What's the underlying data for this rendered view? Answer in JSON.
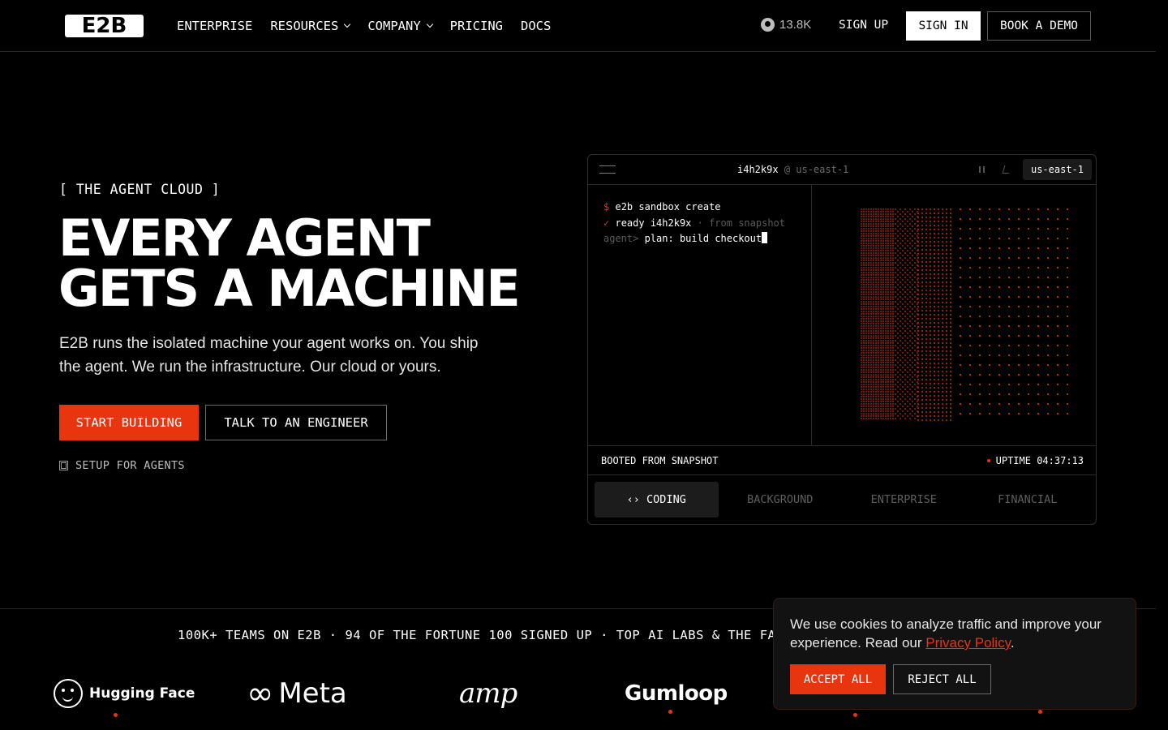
{
  "nav": {
    "logo": "E2B",
    "links": [
      {
        "label": "ENTERPRISE",
        "dropdown": false
      },
      {
        "label": "RESOURCES",
        "dropdown": true
      },
      {
        "label": "COMPANY",
        "dropdown": true
      },
      {
        "label": "PRICING",
        "dropdown": false
      },
      {
        "label": "DOCS",
        "dropdown": false
      }
    ],
    "github_icon": "github-icon",
    "github_stars": "13.8K",
    "sign_up": "SIGN UP",
    "sign_in": "SIGN IN",
    "book_demo": "BOOK A DEMO"
  },
  "hero": {
    "eyebrow": "[ THE AGENT CLOUD ]",
    "headline_line1": "EVERY AGENT",
    "headline_line2": "GETS A MACHINE",
    "subtext": "E2B runs the isolated machine your agent works on. You ship the agent. We run the infrastructure. Our cloud or yours.",
    "cta_primary": "START BUILDING",
    "cta_secondary": "TALK TO AN ENGINEER",
    "setup_link": "SETUP FOR AGENTS"
  },
  "terminal": {
    "sandbox_id": "i4h2k9x",
    "region_suffix": "@ us-east-1",
    "region_badge": "us-east-1",
    "lines": {
      "l1_prompt": "$",
      "l1_cmd": "e2b sandbox create",
      "l2_check": "✓",
      "l2_text": "ready i4h2k9x",
      "l2_dim": "· from snapshot",
      "l3_prompt": "agent>",
      "l3_text": "plan: build checkout"
    },
    "status_left": "BOOTED FROM SNAPSHOT",
    "status_right": "UPTIME 04:37:13",
    "tabs": [
      {
        "label": "‹› CODING",
        "active": true
      },
      {
        "label": "BACKGROUND",
        "active": false
      },
      {
        "label": "ENTERPRISE",
        "active": false
      },
      {
        "label": "FINANCIAL",
        "active": false
      }
    ],
    "accent_color": "#e8340f"
  },
  "social_proof": {
    "tagline": "100K+ TEAMS ON E2B · 94 OF THE FORTUNE 100 SIGNED UP · TOP AI LABS & THE FA",
    "logos": {
      "hugging_face": "Hugging Face",
      "meta": "Meta",
      "amp": "amp",
      "gumloop": "Gumloop"
    }
  },
  "cookie": {
    "text": "We use cookies to analyze traffic and improve your experience. Read our ",
    "link": "Privacy Policy",
    "period": ".",
    "accept": "ACCEPT ALL",
    "reject": "REJECT ALL"
  }
}
